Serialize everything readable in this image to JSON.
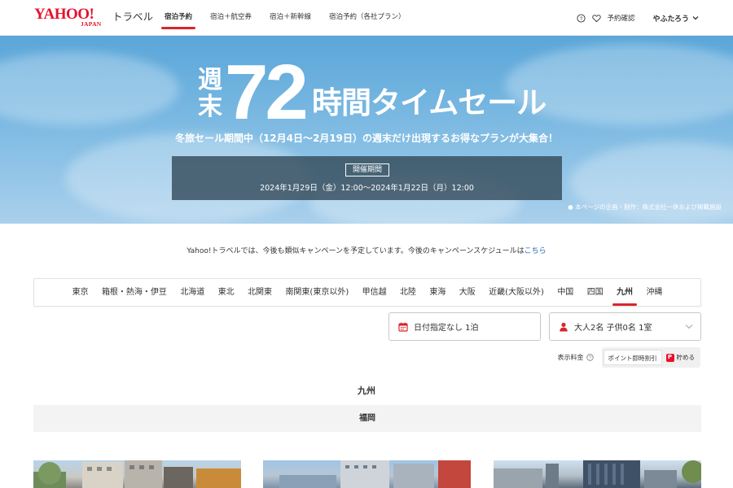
{
  "header": {
    "logo_main": "YAHOO!",
    "logo_sub": "JAPAN",
    "logo_service": "トラベル",
    "nav": [
      {
        "label": "宿泊予約",
        "active": true
      },
      {
        "label": "宿泊＋航空券",
        "active": false
      },
      {
        "label": "宿泊＋新幹線",
        "active": false
      },
      {
        "label": "宿泊予約（各社プラン）",
        "active": false
      }
    ],
    "reservation_link": "予約確認",
    "user_name": "やふたろう",
    "icons": [
      "help-icon",
      "heart-icon",
      "chevron-down-icon"
    ]
  },
  "banner": {
    "headline_prefix": "週末",
    "headline_number": "72",
    "headline_rest": "時間タイムセール",
    "subheadline": "冬旅セール期間中（12月4日〜2月19日）の週末だけ出現するお得なプランが大集合！",
    "period_label": "開催期間",
    "period_dates": "2024年1月29日（金）12:00〜2024年1月22日（月）12:00",
    "credit": "● 本ページの企画・制作：株式会社一休および掲載施設"
  },
  "notice": {
    "text": "Yahoo!トラベルでは、今後も類似キャンペーンを予定しています。今後のキャンペーンスケジュールは",
    "link": "こちら"
  },
  "regions": {
    "items": [
      "東京",
      "箱根・熱海・伊豆",
      "北海道",
      "東北",
      "北関東",
      "南関東(東京以外)",
      "甲信越",
      "北陸",
      "東海",
      "大阪",
      "近畿(大阪以外)",
      "中国",
      "四国",
      "九州",
      "沖縄"
    ],
    "active": "九州"
  },
  "search": {
    "date": "日付指定なし 1泊",
    "guests": "大人2名 子供0名 1室"
  },
  "price_display": {
    "label": "表示料金",
    "options": [
      "ポイント即時割引",
      "貯める"
    ],
    "selected": "ポイント即時割引"
  },
  "section": {
    "title": "九州",
    "prefecture": "福岡"
  },
  "colors": {
    "brand_red": "#e8112d",
    "accent_underline": "#d9262a",
    "link_blue": "#2d6bbd"
  }
}
